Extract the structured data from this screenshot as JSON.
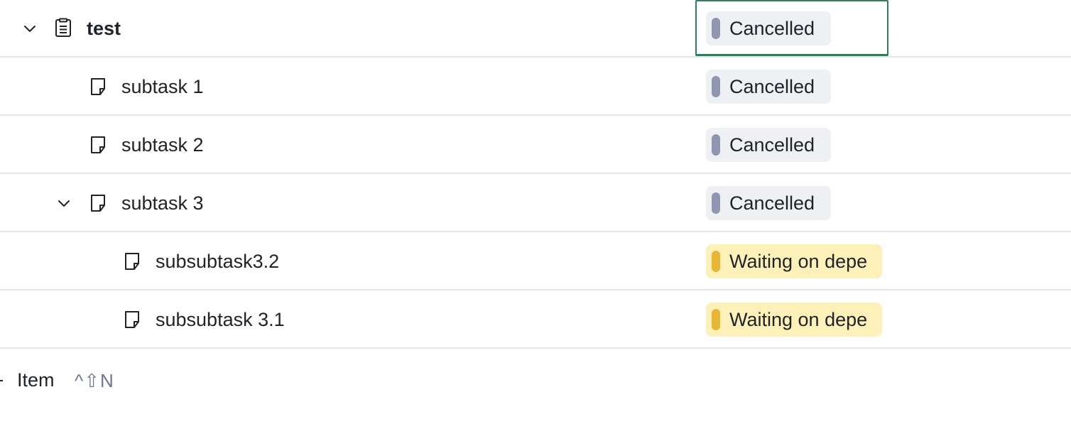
{
  "rows": [
    {
      "title": "test",
      "status": "Cancelled",
      "status_color": "#8e96b0",
      "icon": "clipboard-icon",
      "expanded": true,
      "selected_cell": true
    },
    {
      "title": "subtask 1",
      "status": "Cancelled",
      "status_color": "#8e96b0",
      "icon": "note-icon"
    },
    {
      "title": "subtask 2",
      "status": "Cancelled",
      "status_color": "#8e96b0",
      "icon": "note-icon"
    },
    {
      "title": "subtask 3",
      "status": "Cancelled",
      "status_color": "#8e96b0",
      "icon": "note-icon",
      "expanded": true
    },
    {
      "title": "subsubtask3.2",
      "status": "Waiting on depe",
      "status_color": "#e7b733",
      "icon": "note-icon"
    },
    {
      "title": "subsubtask 3.1",
      "status": "Waiting on depe",
      "status_color": "#e7b733",
      "icon": "note-icon"
    }
  ],
  "add_item": {
    "label": "Item",
    "shortcut": "^⇧N"
  },
  "colors": {
    "selection_border": "#2e7d5b",
    "cancelled_pill_bg": "#eef0f4",
    "waiting_pill_bg": "#fdf0b8"
  }
}
